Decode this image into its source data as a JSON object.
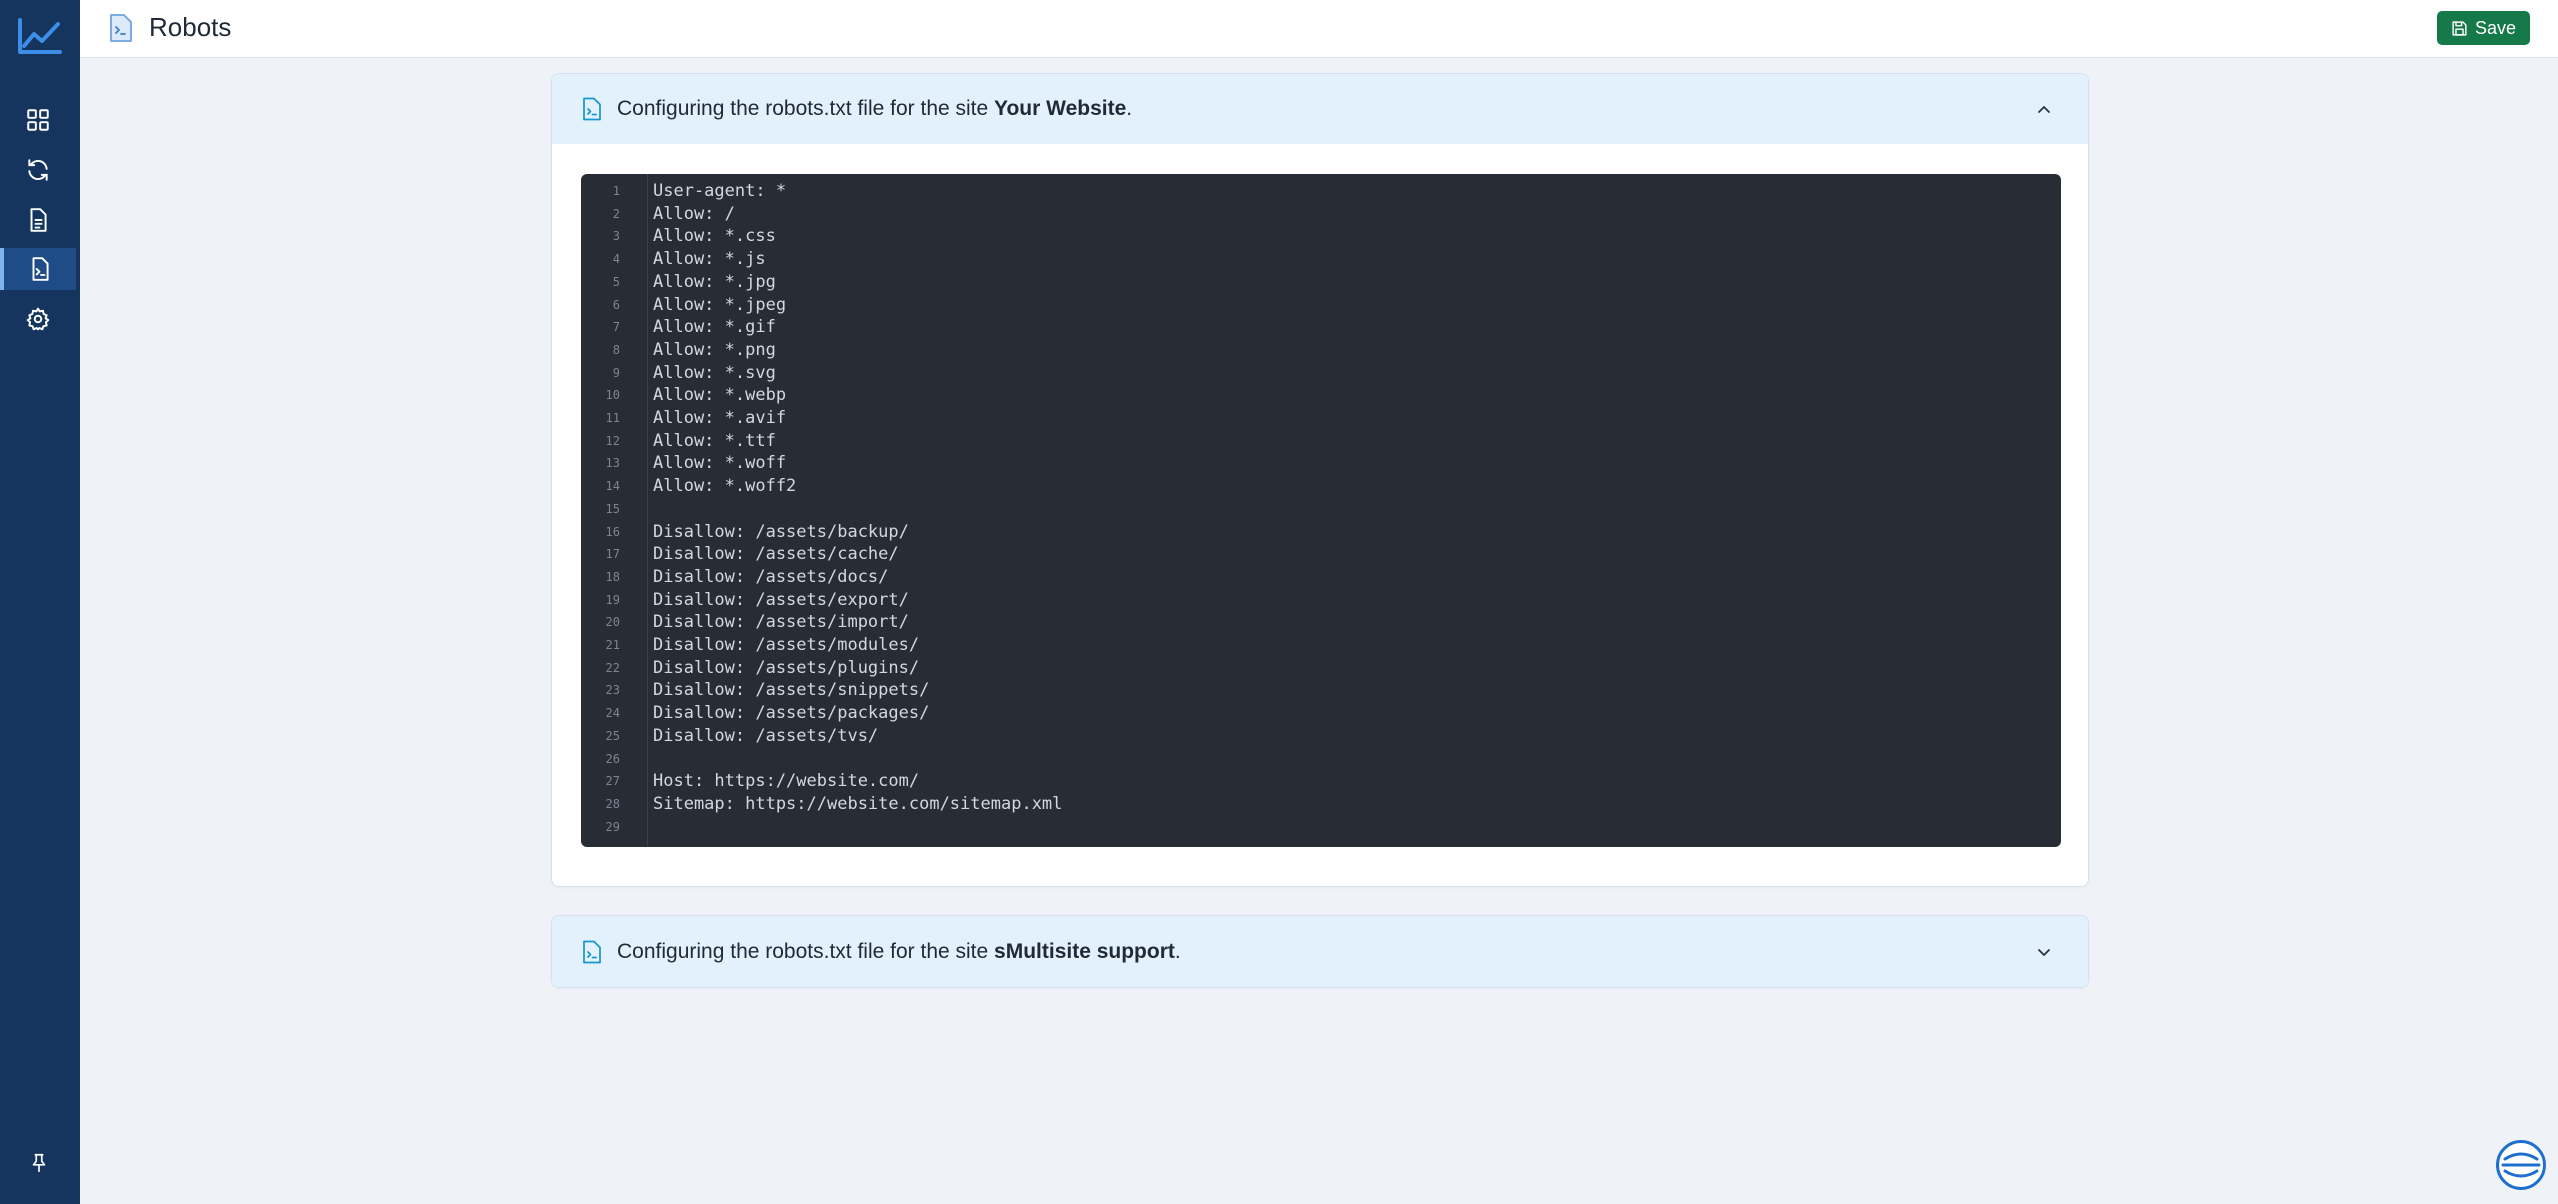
{
  "header": {
    "title": "Robots",
    "save_label": "Save"
  },
  "sidebar": {
    "items": [
      {
        "name": "dashboard-icon",
        "active": false
      },
      {
        "name": "sync-icon",
        "active": false
      },
      {
        "name": "document-icon",
        "active": false
      },
      {
        "name": "robots-file-icon",
        "active": true
      },
      {
        "name": "gear-icon",
        "active": false
      }
    ]
  },
  "panels": [
    {
      "prefix": "Configuring the robots.txt file for the site ",
      "site": "Your Website",
      "suffix": ".",
      "expanded": true
    },
    {
      "prefix": "Configuring the robots.txt file for the site ",
      "site": "sMultisite support",
      "suffix": ".",
      "expanded": false
    }
  ],
  "editor": {
    "lines": [
      "User-agent: *",
      "Allow: /",
      "Allow: *.css",
      "Allow: *.js",
      "Allow: *.jpg",
      "Allow: *.jpeg",
      "Allow: *.gif",
      "Allow: *.png",
      "Allow: *.svg",
      "Allow: *.webp",
      "Allow: *.avif",
      "Allow: *.ttf",
      "Allow: *.woff",
      "Allow: *.woff2",
      "",
      "Disallow: /assets/backup/",
      "Disallow: /assets/cache/",
      "Disallow: /assets/docs/",
      "Disallow: /assets/export/",
      "Disallow: /assets/import/",
      "Disallow: /assets/modules/",
      "Disallow: /assets/plugins/",
      "Disallow: /assets/snippets/",
      "Disallow: /assets/packages/",
      "Disallow: /assets/tvs/",
      "",
      "Host: https://website.com/",
      "Sitemap: https://website.com/sitemap.xml",
      ""
    ]
  },
  "colors": {
    "sidebar_bg": "#15355f",
    "accent": "#0ea5e9",
    "save_bg": "#16794a",
    "editor_bg": "#282c34"
  }
}
